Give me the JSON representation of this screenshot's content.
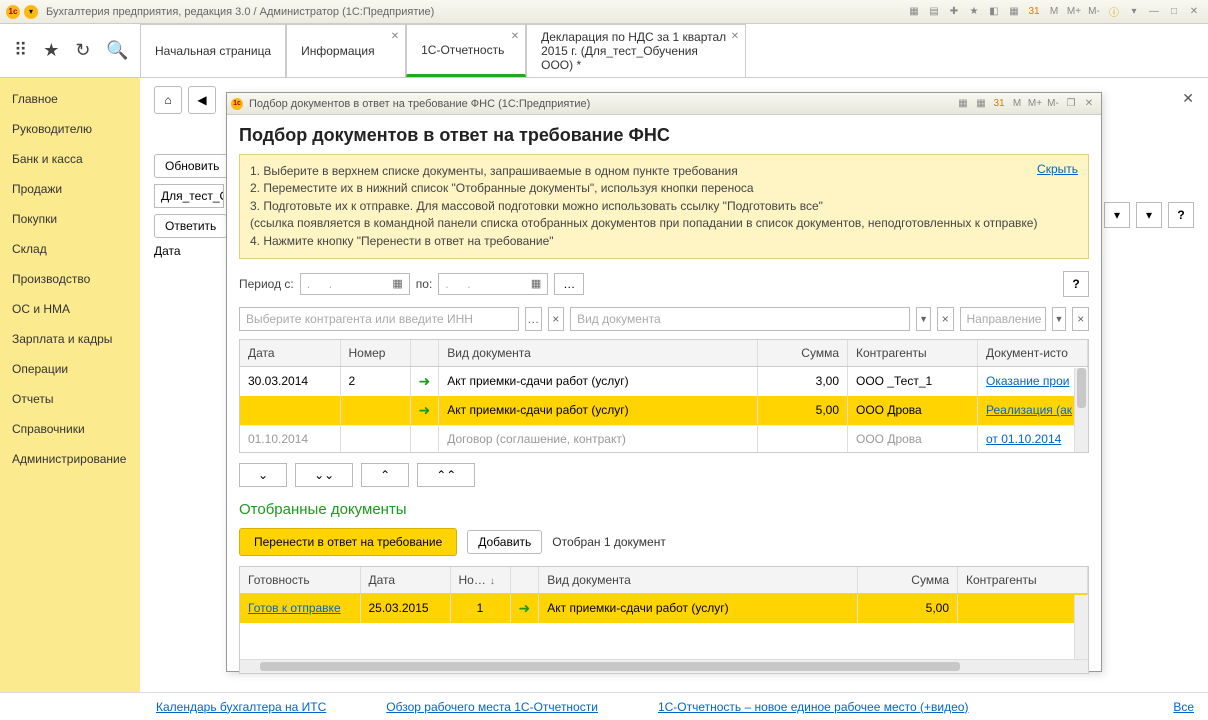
{
  "titlebar": {
    "text": "Бухгалтерия предприятия, редакция 3.0 / Администратор  (1С:Предприятие)"
  },
  "topTabs": [
    {
      "label": "Начальная страница",
      "closable": false
    },
    {
      "label": "Информация",
      "closable": true
    },
    {
      "label": "1С-Отчетность",
      "closable": true,
      "active": true
    },
    {
      "label": "Декларация по НДС за 1 квартал 2015 г. (Для_тест_Обучения ООО) *",
      "closable": true
    }
  ],
  "leftnav": [
    "Главное",
    "Руководителю",
    "Банк и касса",
    "Продажи",
    "Покупки",
    "Склад",
    "Производство",
    "ОС и НМА",
    "Зарплата и кадры",
    "Операции",
    "Отчеты",
    "Справочники",
    "Администрирование"
  ],
  "backpage": {
    "refresh": "Обновить",
    "org": "Для_тест_О",
    "reply": "Ответить",
    "dateLabel": "Дата"
  },
  "dialog": {
    "winTitle": "Подбор документов в ответ на требование ФНС  (1С:Предприятие)",
    "heading": "Подбор документов в ответ на требование ФНС",
    "help": {
      "l1": "1. Выберите в верхнем списке документы, запрашиваемые в одном пункте требования",
      "l2": "2. Переместите их в нижний список \"Отобранные документы\", используя кнопки переноса",
      "l3": "3. Подготовьте их к отправке. Для массовой подготовки можно использовать ссылку \"Подготовить все\"",
      "l3b": "(ссылка появляется в командной панели списка отобранных документов при попадании в список документов, неподготовленных к отправке)",
      "l4": "4. Нажмите кнопку \"Перенести в ответ на требование\"",
      "hide": "Скрыть"
    },
    "period": {
      "from": "Период с:",
      "to": "по:"
    },
    "filters": {
      "contr": "Выберите контрагента или введите ИНН",
      "doct": "Вид документа",
      "dir": "Направление"
    },
    "grid1": {
      "cols": [
        "Дата",
        "Номер",
        "",
        "Вид документа",
        "Сумма",
        "Контрагенты",
        "Документ-исто"
      ],
      "rows": [
        {
          "d": "30.03.2014",
          "n": "2",
          "t": "Акт приемки-сдачи работ (услуг)",
          "s": "3,00",
          "c": "ООО _Тест_1",
          "src": "Оказание прои"
        },
        {
          "d": "",
          "n": "",
          "t": "Акт приемки-сдачи работ (услуг)",
          "s": "5,00",
          "c": "ООО Дрова",
          "src": "Реализация (ак",
          "sel": true
        },
        {
          "d": "01.10.2014",
          "n": "",
          "t": "Договор (соглашение, контракт)",
          "s": "",
          "c": "ООО Дрова",
          "src": "от 01.10.2014",
          "cut": true
        }
      ]
    },
    "selTitle": "Отобранные документы",
    "transferBtn": "Перенести в ответ на требование",
    "addBtn": "Добавить",
    "selInfo": "Отобран 1 документ",
    "grid2": {
      "cols": [
        "Готовность",
        "Дата",
        "Но…",
        "",
        "Вид документа",
        "Сумма",
        "Контрагенты"
      ],
      "rows": [
        {
          "r": "Готов к отправке",
          "d": "25.03.2015",
          "n": "1",
          "t": "Акт приемки-сдачи работ (услуг)",
          "s": "5,00",
          "c": ""
        }
      ]
    }
  },
  "footer": {
    "l1": "Календарь бухгалтера на ИТС",
    "l2": "Обзор рабочего места 1С-Отчетности",
    "l3": "1С-Отчетность – новое единое рабочее место (+видео)",
    "all": "Все"
  },
  "winIcons": {
    "m": "M",
    "mp": "M+",
    "mm": "M-"
  }
}
